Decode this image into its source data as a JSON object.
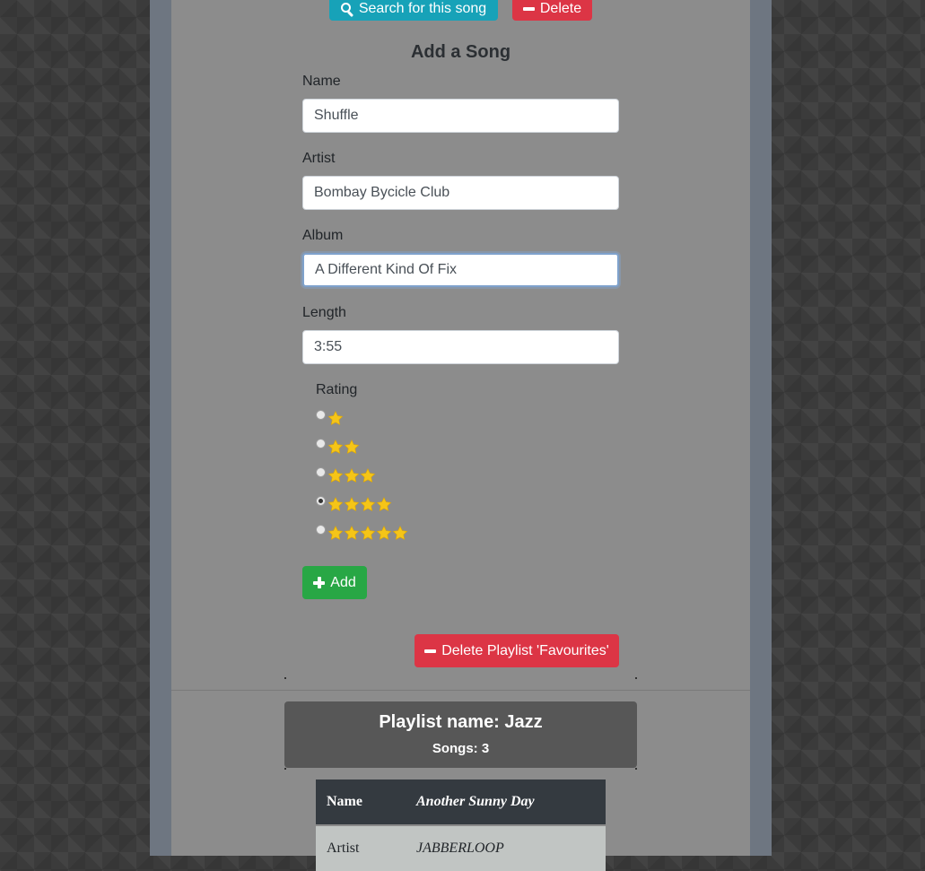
{
  "top_actions": {
    "search_label": "Search for this song",
    "delete_label": "Delete"
  },
  "form": {
    "title": "Add a Song",
    "name_label": "Name",
    "name_value": "Shuffle",
    "artist_label": "Artist",
    "artist_value": "Bombay Bycicle Club",
    "album_label": "Album",
    "album_value": "A Different Kind Of Fix",
    "length_label": "Length",
    "length_value": "3:55",
    "rating_label": "Rating",
    "rating_selected": 4,
    "rating_options": [
      1,
      2,
      3,
      4,
      5
    ],
    "add_label": "Add"
  },
  "delete_playlist_label": "Delete Playlist 'Favourites'",
  "playlist": {
    "name": "Playlist name: Jazz",
    "songs": "Songs: 3",
    "table": {
      "name_header": "Name",
      "name_value": "Another Sunny Day",
      "artist_header": "Artist",
      "artist_value": "JABBERLOOP"
    }
  },
  "colors": {
    "accent_info": "#17a2b8",
    "danger": "#dc3545",
    "success": "#28a745",
    "star": "#f5c518"
  }
}
